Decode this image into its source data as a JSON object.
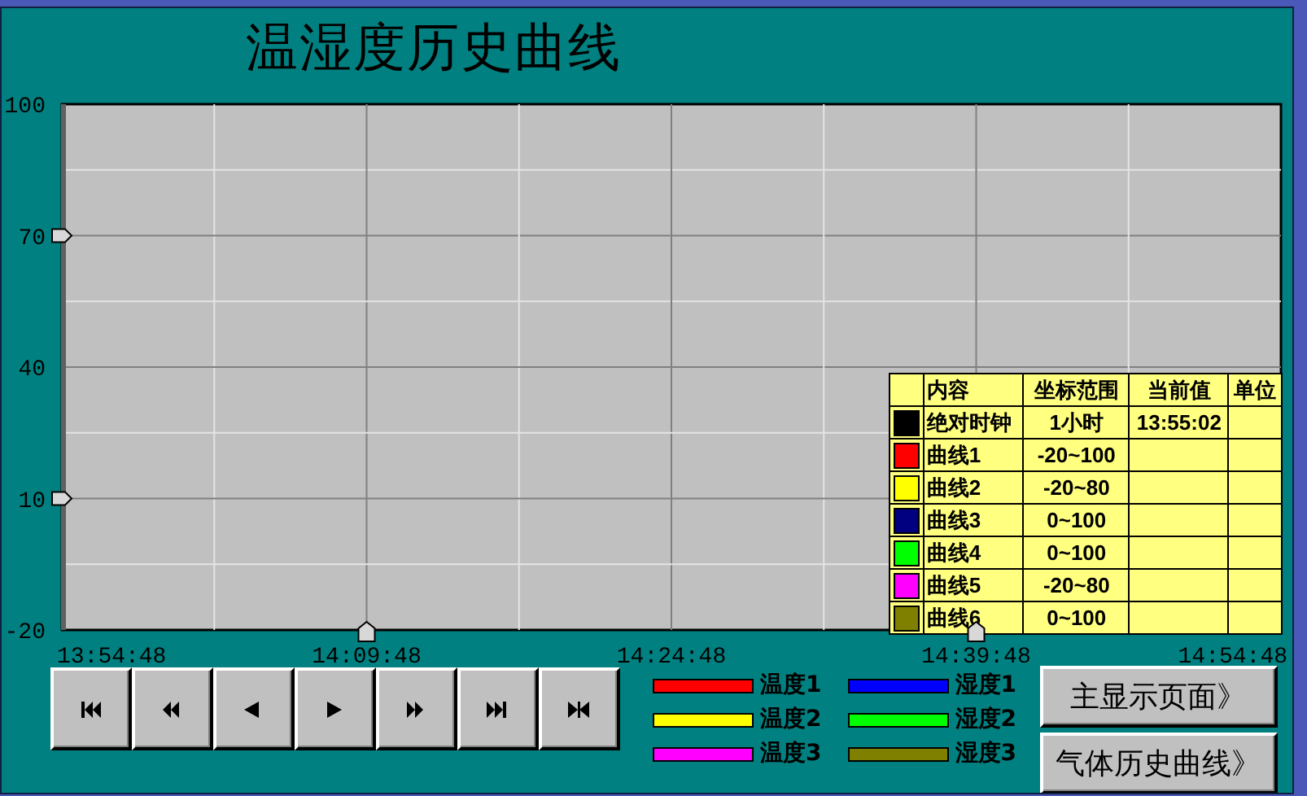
{
  "title": "温湿度历史曲线",
  "chart": {
    "chart_data": {
      "type": "line",
      "grid": true,
      "ylim": [
        -20,
        100
      ],
      "yticks": [
        -20,
        10,
        40,
        70,
        100
      ],
      "categories": [
        "13:54:48",
        "14:09:48",
        "14:24:48",
        "14:39:48",
        "14:54:48"
      ]
    }
  },
  "table": {
    "columns": [
      "内容",
      "坐标范围",
      "当前值",
      "单位"
    ],
    "rows": [
      {
        "color": "#000000",
        "name": "绝对时钟",
        "range": "1小时",
        "value": "13:55:02"
      },
      {
        "color": "#ff0000",
        "name": "曲线1",
        "range": "-20~100"
      },
      {
        "color": "#ffff00",
        "name": "曲线2",
        "range": "-20~80"
      },
      {
        "color": "#000080",
        "name": "曲线3",
        "range": "0~100"
      },
      {
        "color": "#00ff00",
        "name": "曲线4",
        "range": "0~100"
      },
      {
        "color": "#ff00ff",
        "name": "曲线5",
        "range": "-20~80"
      },
      {
        "color": "#808000",
        "name": "曲线6",
        "range": "0~100"
      }
    ]
  },
  "controls": [
    {
      "kind": "first"
    },
    {
      "kind": "prev_page"
    },
    {
      "kind": "prev"
    },
    {
      "kind": "next"
    },
    {
      "kind": "next_page"
    },
    {
      "kind": "last"
    },
    {
      "kind": "fit"
    }
  ],
  "legend": [
    {
      "label": "温度1",
      "color": "#ff0000"
    },
    {
      "label": "湿度1",
      "color": "#0000ff"
    },
    {
      "label": "温度2",
      "color": "#ffff00"
    },
    {
      "label": "湿度2",
      "color": "#00ff00"
    },
    {
      "label": "温度3",
      "color": "#ff00ff"
    },
    {
      "label": "湿度3",
      "color": "#808000"
    }
  ],
  "nav_buttons": [
    "主显示页面》",
    "气体历史曲线》"
  ]
}
